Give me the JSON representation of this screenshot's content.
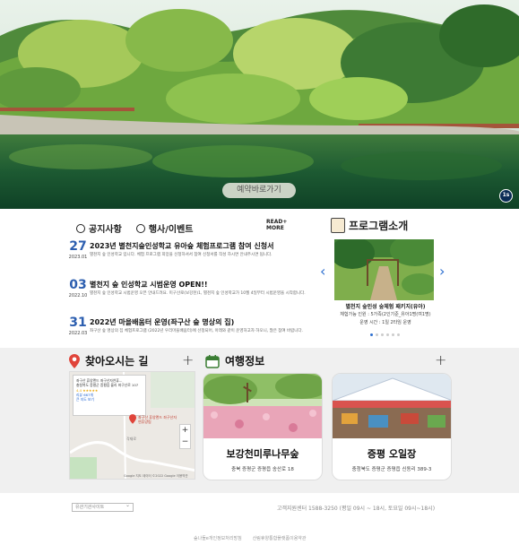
{
  "hero": {
    "reserve_label": "예약바로가기",
    "pager_label": "1s"
  },
  "tabs": [
    {
      "label": "공지사항"
    },
    {
      "label": "행사/이벤트"
    }
  ],
  "read_more": {
    "line1": "READ+",
    "line2": "MORE"
  },
  "news": [
    {
      "day": "27",
      "ym": "2023.01",
      "title": "2023년 별천지숲인성학교 유아숲 체험프로그램 참여 신청서",
      "desc": "별천지 숲 인성학교 입니다. 체험 프로그램 희망을 신청하셔서 참여 신청서를 작성 하시면 안내주시면 됩니다."
    },
    {
      "day": "03",
      "ym": "2022.10",
      "title": "별천지 숲 인성학교 시범운영 OPEN!!",
      "desc": "별천지 숲 인성학교 시범운영 오픈 안내드려요. 미구산로(보강천)1, 별천지 숲 인성학교가 10월 4일부터 시범운영을 시작합니다."
    },
    {
      "day": "31",
      "ym": "2022.03",
      "title": "2022년 마을배움터 운영(좌구산 숲 명상의 집)",
      "desc": "좌구산 숲 명상의 집 체험프로그램 (2022년 우리마을배움터)에 선정되어, 아래와 같이 운영하고자 하오니, 많은 참여 바랍니다."
    }
  ],
  "program": {
    "heading": "프로그램소개",
    "title": "별천지 숲인성 숲체험 패키지(유아)",
    "sub": "체험가능 인원 : 5가족(2인기준_유아1명(여1명)",
    "time": "운영 시간 : 1일 2타임 운영"
  },
  "directions": {
    "heading": "찾아오시는 길",
    "map_card": {
      "name": "좌구산 휴양랜드 좌구산자연휴...",
      "addr": "충청북도 증평군 증평읍 율리 좌구산로 107",
      "rating": "4.4 ★★★★★",
      "reviews": "리뷰 667개",
      "larger": "큰 지도 보기",
      "pin_label": "좌구산 휴양랜드 좌구산자연휴양림",
      "road": "각재로",
      "credit": "Google 지도 데이터 ©2022 Google 이용약관"
    }
  },
  "travel": {
    "heading": "여행정보",
    "cards": [
      {
        "title": "보강천미루나무숲",
        "addr": "충북 증평군 증평읍 송산로 18"
      },
      {
        "title": "증평 오일장",
        "addr": "충청북도 증평군 증평읍 신동리 389-3"
      }
    ]
  },
  "footer": {
    "select_placeholder": "유관기관사이트",
    "cs": "고객지원센터 1588-3250 (평일 09시 ~ 18시, 토요일 09시~18시)",
    "links": [
      "숲나들e개인정보처리방침",
      "산림휴양통합플랫폼이용약관"
    ]
  },
  "colors": {
    "accent": "#2d5fb0",
    "band": "#f0f0f0"
  }
}
